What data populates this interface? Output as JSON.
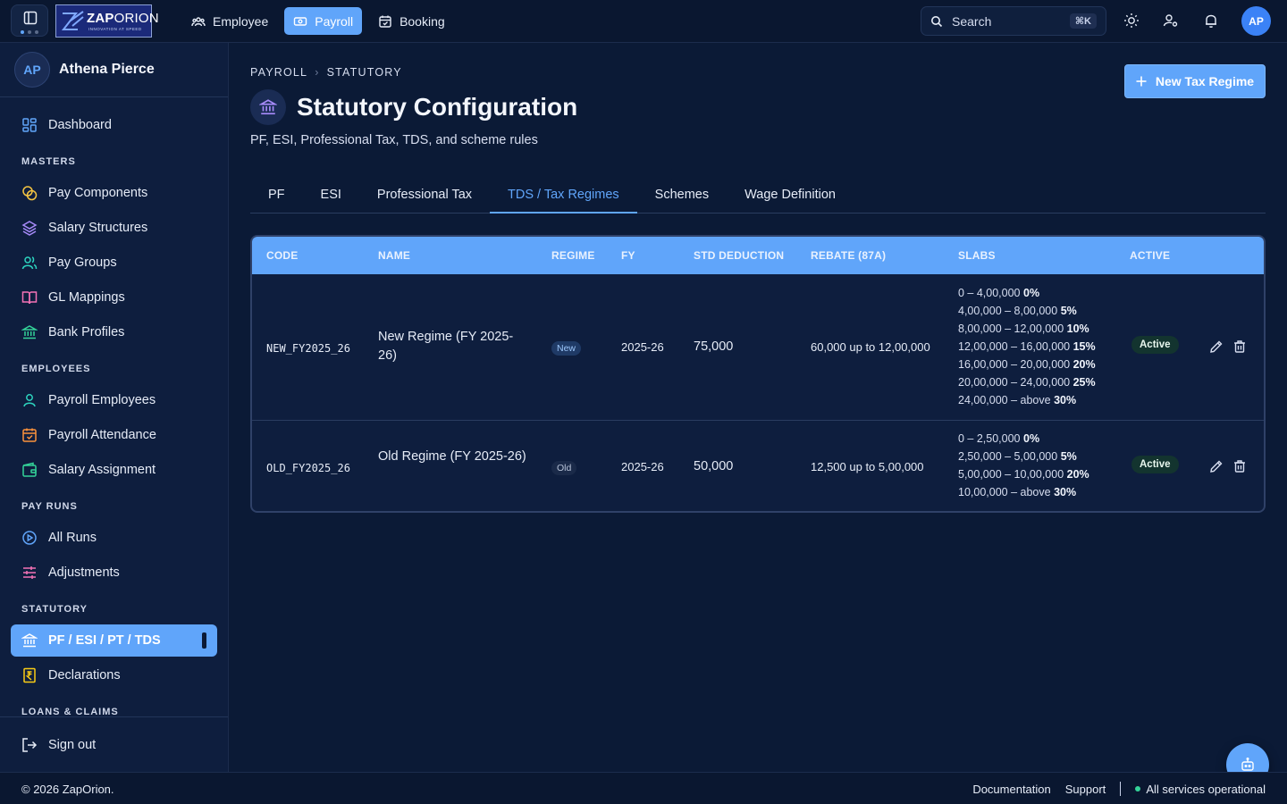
{
  "brand": {
    "name_bold": "ZAP",
    "name_light": "ORION",
    "tagline": "INNOVATION AT SPEED"
  },
  "topnav": [
    {
      "label": "Employee",
      "icon": "people-icon",
      "active": false
    },
    {
      "label": "Payroll",
      "icon": "cash-icon",
      "active": true
    },
    {
      "label": "Booking",
      "icon": "calendar-icon",
      "active": false
    }
  ],
  "search": {
    "placeholder": "Search",
    "shortcut": "⌘K"
  },
  "top_avatar": "AP",
  "user": {
    "initials": "AP",
    "name": "Athena Pierce"
  },
  "sidebar": {
    "dashboard": "Dashboard",
    "sections": {
      "masters": "MASTERS",
      "employees": "EMPLOYEES",
      "pay_runs": "PAY RUNS",
      "statutory": "STATUTORY",
      "loans": "LOANS & CLAIMS"
    },
    "items": {
      "pay_components": "Pay Components",
      "salary_structures": "Salary Structures",
      "pay_groups": "Pay Groups",
      "gl_mappings": "GL Mappings",
      "bank_profiles": "Bank Profiles",
      "payroll_employees": "Payroll Employees",
      "payroll_attendance": "Payroll Attendance",
      "salary_assignment": "Salary Assignment",
      "all_runs": "All Runs",
      "adjustments": "Adjustments",
      "statutory": "PF / ESI / PT / TDS",
      "declarations": "Declarations"
    },
    "sign_out": "Sign out"
  },
  "page": {
    "breadcrumb": [
      "PAYROLL",
      "STATUTORY"
    ],
    "title": "Statutory Configuration",
    "subtitle": "PF, ESI, Professional Tax, TDS, and scheme rules",
    "new_button": "New Tax Regime"
  },
  "tabs": [
    "PF",
    "ESI",
    "Professional Tax",
    "TDS / Tax Regimes",
    "Schemes",
    "Wage Definition"
  ],
  "active_tab": "TDS / Tax Regimes",
  "table": {
    "columns": [
      "CODE",
      "NAME",
      "REGIME",
      "FY",
      "STD DEDUCTION",
      "REBATE (87A)",
      "SLABS",
      "ACTIVE"
    ],
    "rows": [
      {
        "code": "NEW_FY2025_26",
        "name": "New Regime (FY 2025-26)",
        "regime": "New",
        "fy": "2025-26",
        "std_deduction": "75,000",
        "rebate": "60,000 up to 12,00,000",
        "slabs": [
          {
            "range": "0 – 4,00,000",
            "rate": "0%"
          },
          {
            "range": "4,00,000 – 8,00,000",
            "rate": "5%"
          },
          {
            "range": "8,00,000 – 12,00,000",
            "rate": "10%"
          },
          {
            "range": "12,00,000 – 16,00,000",
            "rate": "15%"
          },
          {
            "range": "16,00,000 – 20,00,000",
            "rate": "20%"
          },
          {
            "range": "20,00,000 – 24,00,000",
            "rate": "25%"
          },
          {
            "range": "24,00,000 – above",
            "rate": "30%"
          }
        ],
        "active": "Active"
      },
      {
        "code": "OLD_FY2025_26",
        "name": "Old Regime (FY 2025-26)",
        "regime": "Old",
        "fy": "2025-26",
        "std_deduction": "50,000",
        "rebate": "12,500 up to 5,00,000",
        "slabs": [
          {
            "range": "0 – 2,50,000",
            "rate": "0%"
          },
          {
            "range": "2,50,000 – 5,00,000",
            "rate": "5%"
          },
          {
            "range": "5,00,000 – 10,00,000",
            "rate": "20%"
          },
          {
            "range": "10,00,000 – above",
            "rate": "30%"
          }
        ],
        "active": "Active"
      }
    ]
  },
  "footer": {
    "copyright": "© 2026 ZapOrion.",
    "documentation": "Documentation",
    "support": "Support",
    "status": "All services operational"
  },
  "colors": {
    "accent": "#60a5fa",
    "background": "#0b1a36",
    "sidebar": "#0e1e3e",
    "success": "#34d399"
  }
}
